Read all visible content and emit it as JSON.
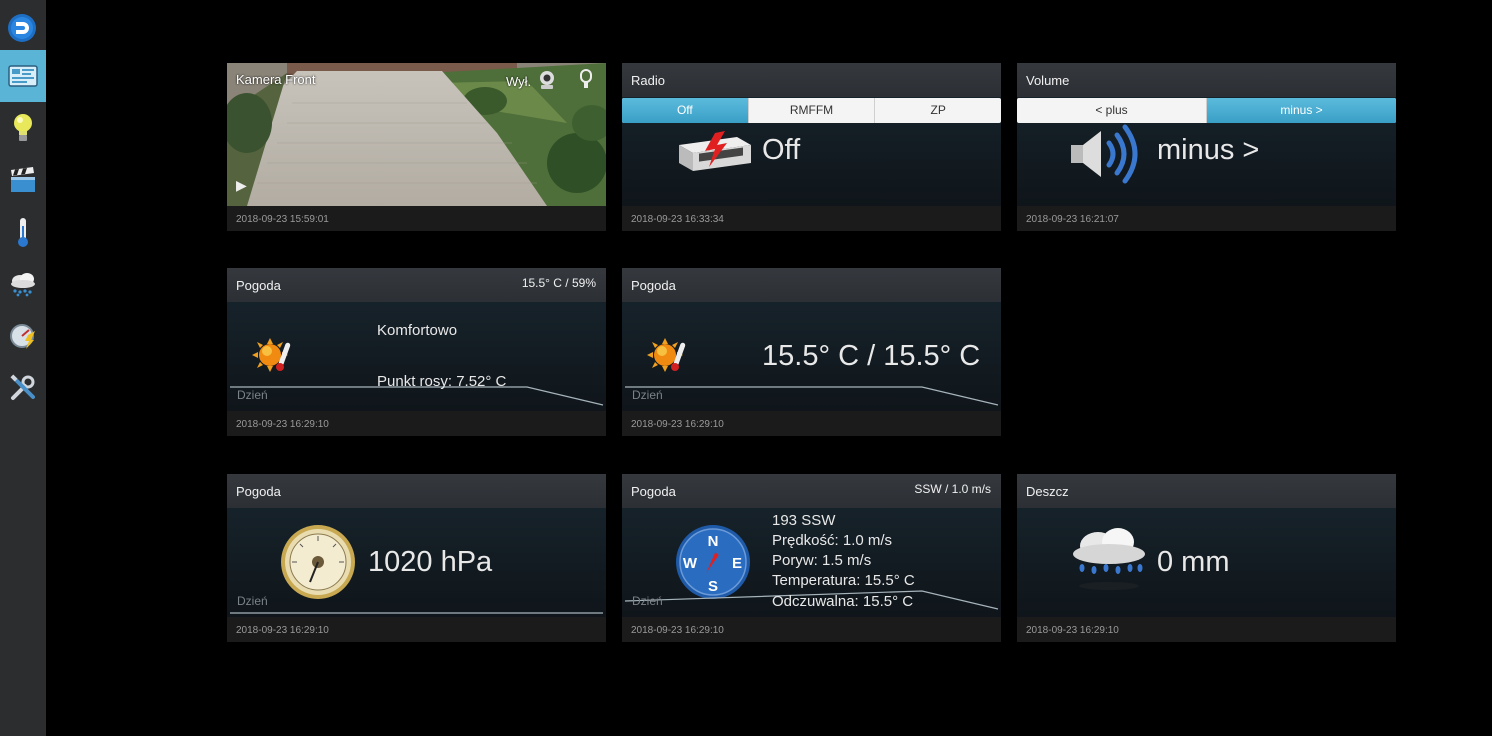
{
  "sidebar": {
    "items": [
      {
        "name": "dashboard",
        "icon": "dashboard-icon",
        "active": true
      },
      {
        "name": "lights",
        "icon": "lightbulb-icon"
      },
      {
        "name": "scenes",
        "icon": "clapperboard-icon"
      },
      {
        "name": "temperature",
        "icon": "thermometer-icon"
      },
      {
        "name": "weather",
        "icon": "rain-cloud-icon"
      },
      {
        "name": "utility",
        "icon": "gauge-icon"
      },
      {
        "name": "setup",
        "icon": "tools-icon"
      }
    ]
  },
  "tiles": {
    "camera": {
      "title": "Kamera Front",
      "status": "Wył.",
      "time": "2018-09-23 15:59:01"
    },
    "radio": {
      "title": "Radio",
      "options": [
        "Off",
        "RMFFM",
        "ZP"
      ],
      "selected": "Off",
      "value": "Off",
      "time": "2018-09-23 16:33:34"
    },
    "volume": {
      "title": "Volume",
      "options": [
        "< plus",
        "minus >"
      ],
      "selected": "minus >",
      "value": "minus >",
      "time": "2018-09-23 16:21:07"
    },
    "comfort": {
      "title": "Pogoda",
      "status": "15.5° C / 59%",
      "line1": "Komfortowo",
      "line2": "Punkt rosy: 7.52° C",
      "range": "Dzień",
      "time": "2018-09-23 16:29:10"
    },
    "temp": {
      "title": "Pogoda",
      "value": "15.5° C / 15.5° C",
      "range": "Dzień",
      "time": "2018-09-23 16:29:10"
    },
    "pressure": {
      "title": "Pogoda",
      "value": "1020 hPa",
      "range": "Dzień",
      "time": "2018-09-23 16:29:10"
    },
    "wind": {
      "title": "Pogoda",
      "status": "SSW / 1.0 m/s",
      "lines": [
        "193 SSW",
        "Prędkość: 1.0 m/s",
        "Poryw: 1.5 m/s",
        "Temperatura: 15.5° C",
        "Odczuwalna: 15.5° C"
      ],
      "compass": [
        "N",
        "W",
        "E",
        "S"
      ],
      "range": "Dzień",
      "time": "2018-09-23 16:29:10"
    },
    "rain": {
      "title": "Deszcz",
      "value": "0 mm",
      "time": "2018-09-23 16:29:10"
    }
  },
  "colors": {
    "accent": "#5ab4d6",
    "background": "#000000",
    "tile_header": "#31353a"
  }
}
